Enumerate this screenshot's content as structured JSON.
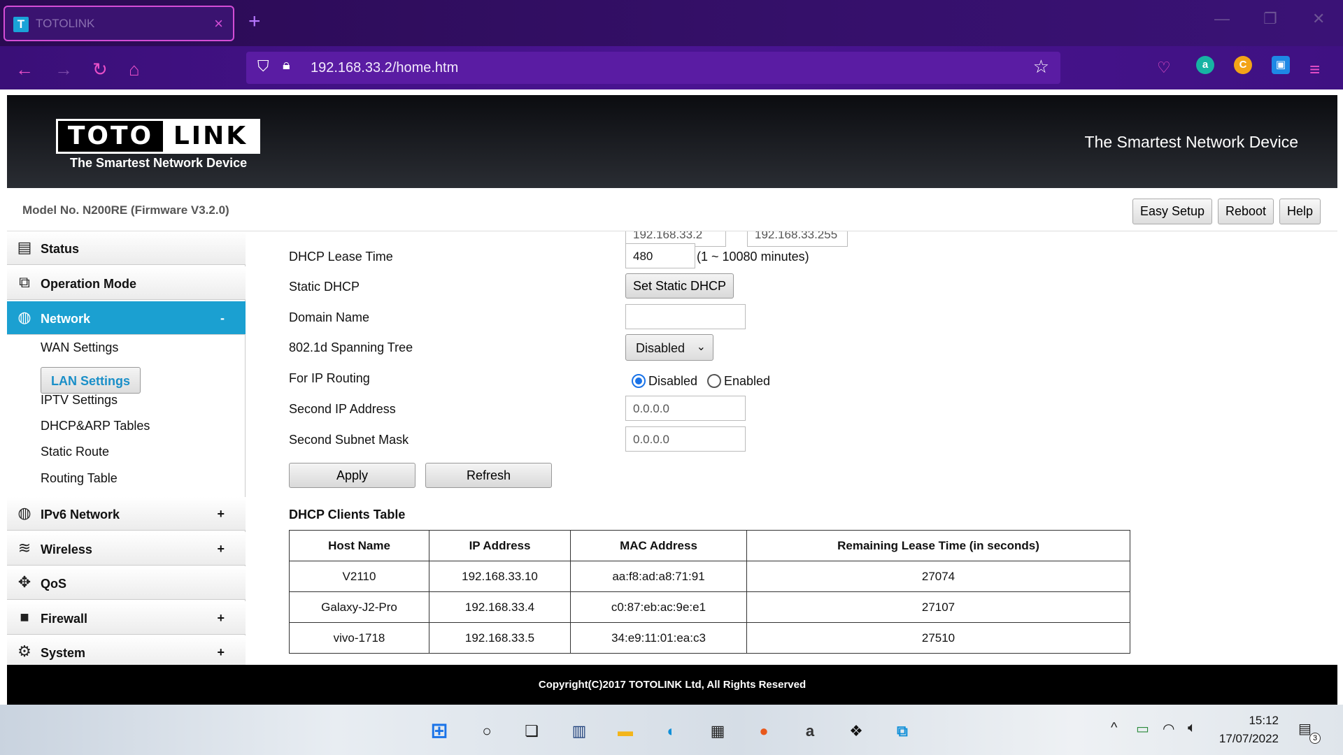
{
  "browser": {
    "tab_title": "TOTOLINK",
    "tab_favicon": "T",
    "url": "192.168.33.2/home.htm"
  },
  "header": {
    "logo_left": "TOTO",
    "logo_right": "LINK",
    "logo_sub": "The Smartest Network Device",
    "tagline": "The Smartest Network Device"
  },
  "modelbar": {
    "model": "Model No. N200RE (Firmware V3.2.0)",
    "buttons": [
      "Easy Setup",
      "Reboot",
      "Help"
    ]
  },
  "sidebar": {
    "menus": [
      {
        "label": "Status",
        "icon": "chat-icon",
        "sign": ""
      },
      {
        "label": "Operation Mode",
        "icon": "mode-icon",
        "sign": ""
      },
      {
        "label": "Network",
        "icon": "globe-icon",
        "sign": "-"
      },
      {
        "label": "IPv6 Network",
        "icon": "globe-icon",
        "sign": "+"
      },
      {
        "label": "Wireless",
        "icon": "wifi-icon",
        "sign": "+"
      },
      {
        "label": "QoS",
        "icon": "qos-icon",
        "sign": ""
      },
      {
        "label": "Firewall",
        "icon": "lock-icon",
        "sign": "+"
      },
      {
        "label": "System",
        "icon": "gear-icon",
        "sign": "+"
      }
    ],
    "network_sub": [
      "WAN Settings",
      "LAN Settings",
      "IPTV Settings",
      "DHCP&ARP Tables",
      "Static Route",
      "Routing Table"
    ],
    "selected_sub": "LAN Settings"
  },
  "form": {
    "range_start": "192.168.33.2",
    "range_end": "192.168.33.255",
    "lease_label": "DHCP Lease Time",
    "lease_value": "480",
    "lease_hint": "(1 ~ 10080 minutes)",
    "static_label": "Static DHCP",
    "static_button": "Set Static DHCP",
    "domain_label": "Domain Name",
    "domain_value": "",
    "stp_label": "802.1d Spanning Tree",
    "stp_value": "Disabled",
    "routing_label": "For IP Routing",
    "routing_disabled": "Disabled",
    "routing_enabled": "Enabled",
    "second_ip_label": "Second IP Address",
    "second_ip_value": "0.0.0.0",
    "second_mask_label": "Second Subnet Mask",
    "second_mask_value": "0.0.0.0",
    "apply": "Apply",
    "refresh": "Refresh"
  },
  "dhcp_table": {
    "title": "DHCP Clients Table",
    "headers": [
      "Host Name",
      "IP Address",
      "MAC Address",
      "Remaining Lease Time (in seconds)"
    ],
    "rows": [
      [
        "V2110",
        "192.168.33.10",
        "aa:f8:ad:a8:71:91",
        "27074"
      ],
      [
        "Galaxy-J2-Pro",
        "192.168.33.4",
        "c0:87:eb:ac:9e:e1",
        "27107"
      ],
      [
        "vivo-1718",
        "192.168.33.5",
        "34:e9:11:01:ea:c3",
        "27510"
      ]
    ]
  },
  "footer": "Copyright(C)2017 TOTOLINK Ltd, All Rights Reserved",
  "taskbar": {
    "time": "15:12",
    "date": "17/07/2022",
    "notification_count": "3"
  }
}
